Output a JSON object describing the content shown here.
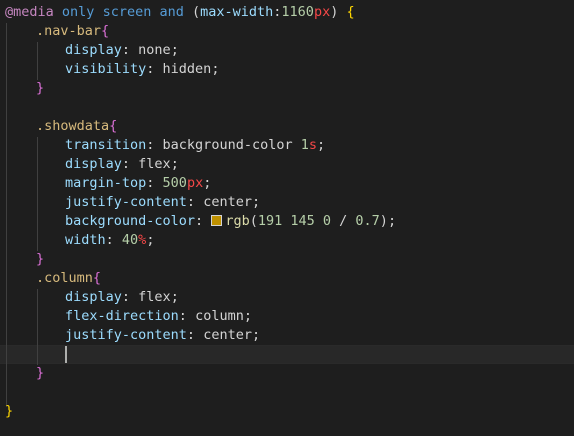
{
  "colors": {
    "background": "#1e1e1e",
    "at_rule": "#c586c0",
    "keyword": "#569cd6",
    "selector": "#d7ba7d",
    "property": "#9cdcfe",
    "value": "#ce9178",
    "plain_value": "#d4d4d4",
    "number": "#b5cea8",
    "unit": "#f44747",
    "punctuation": "#d4d4d4",
    "brace_level1": "#ffd700",
    "brace_level2": "#da70d6",
    "swatch": "#bf9100"
  },
  "code": {
    "l1": {
      "at": "@media",
      "t1": " only ",
      "t2": "screen",
      "t3": " and ",
      "t4": "(",
      "t5": "max-width",
      "t6": ":",
      "t7": "1160",
      "t8": "px",
      "t9": ")",
      "t10": " ",
      "brace": "{"
    },
    "l2": {
      "sel": ".nav-bar",
      "brace": "{"
    },
    "l3": {
      "prop": "display",
      "colon": ": ",
      "val": "none",
      "semi": ";"
    },
    "l4": {
      "prop": "visibility",
      "colon": ": ",
      "val": "hidden",
      "semi": ";"
    },
    "l5": {
      "brace": "}"
    },
    "l7": {
      "sel": ".showdata",
      "brace": "{"
    },
    "l8": {
      "prop": "transition",
      "colon": ": ",
      "val": "background-color ",
      "num": "1",
      "unit": "s",
      "semi": ";"
    },
    "l9": {
      "prop": "display",
      "colon": ": ",
      "val": "flex",
      "semi": ";"
    },
    "l10": {
      "prop": "margin-top",
      "colon": ": ",
      "num": "500",
      "unit": "px",
      "semi": ";"
    },
    "l11": {
      "prop": "justify-content",
      "colon": ": ",
      "val": "center",
      "semi": ";"
    },
    "l12": {
      "prop": "background-color",
      "colon": ": ",
      "fn": "rgb",
      "args": "(",
      "n1": "191",
      "n2": " 145",
      "n3": " 0",
      "slash": " / ",
      "n4": "0.7",
      "close": ")",
      "semi": ";"
    },
    "l13": {
      "prop": "width",
      "colon": ": ",
      "num": "40",
      "unit": "%",
      "semi": ";"
    },
    "l14": {
      "brace": "}"
    },
    "l15": {
      "sel": ".column",
      "brace": "{"
    },
    "l16": {
      "prop": "display",
      "colon": ": ",
      "val": "flex",
      "semi": ";"
    },
    "l17": {
      "prop": "flex-direction",
      "colon": ": ",
      "val": "column",
      "semi": ";"
    },
    "l18": {
      "prop": "justify-content",
      "colon": ": ",
      "val": "center",
      "semi": ";"
    },
    "l20": {
      "brace": "}"
    },
    "l22": {
      "brace": "}"
    }
  }
}
